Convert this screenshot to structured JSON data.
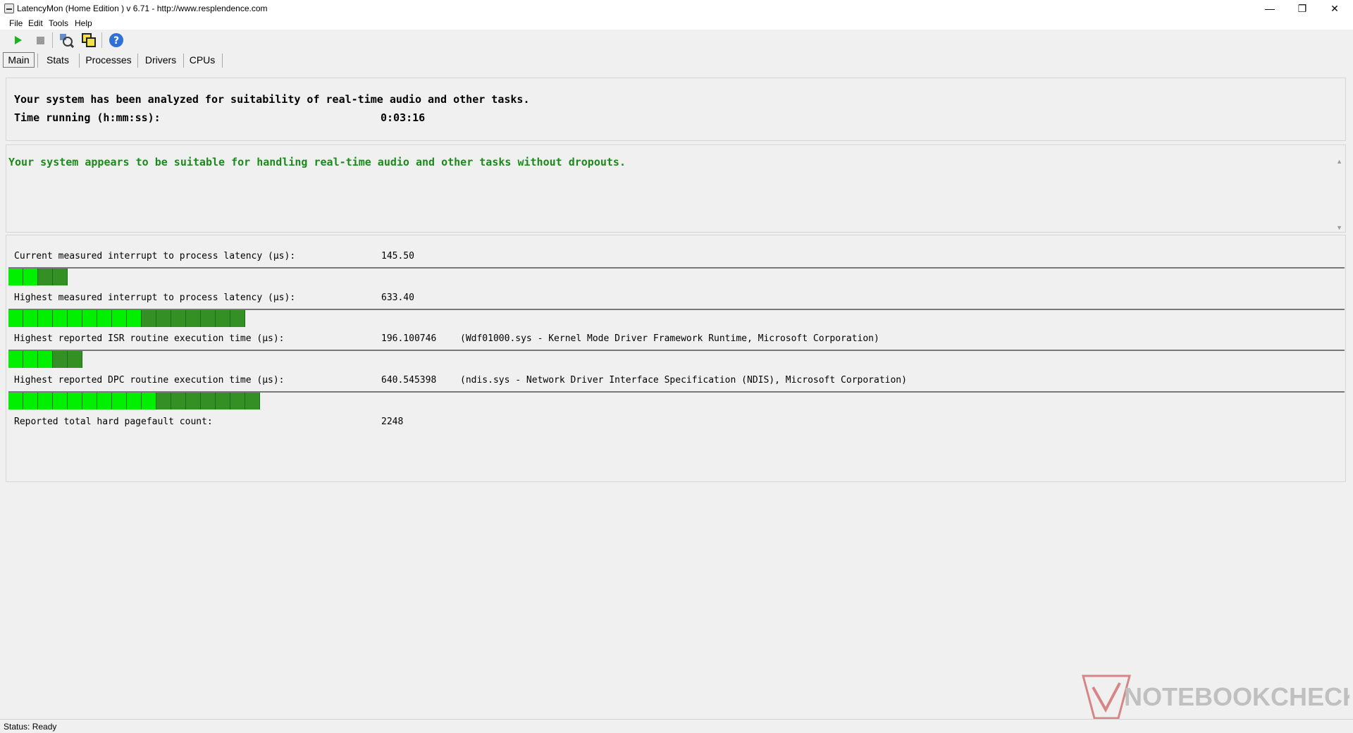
{
  "window": {
    "title": "LatencyMon  (Home Edition )  v 6.71 - http://www.resplendence.com",
    "minimize": "—",
    "restore": "❐",
    "close": "✕"
  },
  "menu": [
    {
      "label": "File"
    },
    {
      "label": "Edit"
    },
    {
      "label": "Tools"
    },
    {
      "label": "Help"
    }
  ],
  "toolbar": {
    "start_icon": "play-icon",
    "stop_icon": "stop-icon",
    "analyze_icon": "driver-analysis-icon",
    "windows_icon": "windows-icon",
    "help_icon": "help-icon",
    "help_glyph": "?"
  },
  "tabs": [
    {
      "label": "Main",
      "active": true
    },
    {
      "label": "Stats",
      "active": false
    },
    {
      "label": "Processes",
      "active": false
    },
    {
      "label": "Drivers",
      "active": false
    },
    {
      "label": "CPUs",
      "active": false
    }
  ],
  "summary": {
    "line1": "Your system has been analyzed for suitability of real-time audio and other tasks.",
    "time_label": "Time running (h:mm:ss):",
    "time_value": "0:03:16"
  },
  "verdict": {
    "text": "Your system appears to be suitable for handling real-time audio and other tasks without dropouts.",
    "color": "#1a8a1a"
  },
  "metrics": [
    {
      "label": "Current measured interrupt to process latency (µs):",
      "value": "145.50",
      "desc": "",
      "bar_segments": 4
    },
    {
      "label": "Highest measured interrupt to process latency (µs):",
      "value": "633.40",
      "desc": "",
      "bar_segments": 16
    },
    {
      "label": "Highest reported ISR routine execution time (µs):",
      "value": "196.100746",
      "desc": "(Wdf01000.sys - Kernel Mode Driver Framework Runtime, Microsoft Corporation)",
      "bar_segments": 5
    },
    {
      "label": "Highest reported DPC routine execution time (µs):",
      "value": "640.545398",
      "desc": "(ndis.sys - Network Driver Interface Specification (NDIS), Microsoft Corporation)",
      "bar_segments": 17
    }
  ],
  "pagefault": {
    "label": "Reported total hard pagefault count:",
    "value": "2248"
  },
  "status": {
    "text": "Status: Ready"
  },
  "watermark": {
    "text": "NOTEBOOKCHECK"
  },
  "colors": {
    "bar_bright": "#00f000",
    "bar_dark": "#2a8a1a",
    "verdict": "#1a8a1a"
  }
}
